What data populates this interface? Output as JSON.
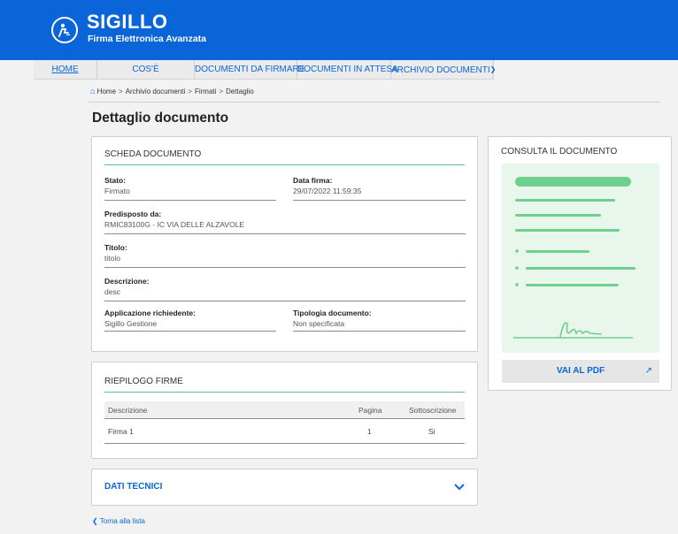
{
  "header": {
    "title": "SIGILLO",
    "subtitle": "Firma Elettronica Avanzata",
    "brand_color": "#0a66d8",
    "logo_icon": "pen-signing-icon"
  },
  "nav": {
    "items": [
      {
        "label": "HOME",
        "active": true
      },
      {
        "label": "COS'È",
        "active": false
      },
      {
        "label": "DOCUMENTI DA FIRMARE",
        "active": false
      },
      {
        "label": "DOCUMENTI IN ATTESA",
        "active": false
      },
      {
        "label": "ARCHIVIO DOCUMENTI",
        "active": false,
        "dropdown": true
      }
    ],
    "dropdown_icon": "chevron-down-icon"
  },
  "breadcrumb": {
    "home_icon": "home-icon",
    "separator": ">",
    "items": [
      "Home",
      "Archivio documenti",
      "Firmati",
      "Dettaglio"
    ]
  },
  "page": {
    "title": "Dettaglio documento"
  },
  "scheda": {
    "title": "SCHEDA DOCUMENTO",
    "fields": {
      "stato": {
        "label": "Stato:",
        "value": "Firmato"
      },
      "data_firma": {
        "label": "Data firma:",
        "value": "29/07/2022 11:59:35"
      },
      "predisposto": {
        "label": "Predisposto da:",
        "value": "RMIC83100G - IC VIA DELLE ALZAVOLE"
      },
      "titolo": {
        "label": "Titolo:",
        "value": "titolo"
      },
      "descrizione": {
        "label": "Descrizione:",
        "value": "desc"
      },
      "applicazione": {
        "label": "Applicazione richiedente:",
        "value": "Sigillo Gestione"
      },
      "tipologia": {
        "label": "Tipologia documento:",
        "value": "Non specificata"
      }
    }
  },
  "riepilogo": {
    "title": "RIEPILOGO FIRME",
    "columns": [
      "Descrizione",
      "Pagina",
      "Sottoscrizione"
    ],
    "rows": [
      {
        "descrizione": "Firma 1",
        "pagina": "1",
        "sottoscrizione": "Si"
      }
    ]
  },
  "dati_tecnici": {
    "title": "DATI TECNICI",
    "toggle_icon": "chevron-down-icon"
  },
  "consulta": {
    "title": "CONSULTA IL DOCUMENTO",
    "button_label": "VAI AL PDF",
    "button_icon": "external-link-icon",
    "preview_color": "#e9f6ec",
    "accent_color": "#5bbf83"
  },
  "back": {
    "label": "Torna alla lista",
    "icon": "chevron-left-icon"
  }
}
